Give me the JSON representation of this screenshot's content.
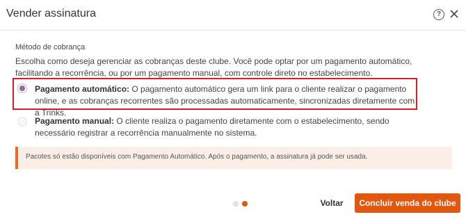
{
  "dialog": {
    "title": "Vender assinatura",
    "help_icon": "question-circle-icon",
    "close_icon": "close-icon"
  },
  "billing": {
    "section_label": "Método de cobrança",
    "description": "Escolha como deseja gerenciar as cobranças deste clube. Você pode optar por um pagamento automático, facilitando a recorrência, ou por um pagamento manual, com controle direto no estabelecimento.",
    "options": [
      {
        "title": "Pagamento automático:",
        "text": " O pagamento automático gera um link para o cliente realizar o pagamento online, e as cobranças recorrentes são processadas automaticamente, sincronizadas diretamente com a Trinks.",
        "selected": true
      },
      {
        "title": "Pagamento manual:",
        "text": " O cliente realiza o pagamento diretamente com o estabelecimento, sendo necessário registrar a recorrência manualmente no sistema.",
        "selected": false
      }
    ]
  },
  "alert": {
    "text": "Pacotes só estão disponíveis com Pagamento Automático. Após o pagamento, a assinatura já pode ser usada."
  },
  "footer": {
    "steps_total": 2,
    "current_step": 2,
    "back_label": "Voltar",
    "submit_label": "Concluir venda do clube"
  },
  "colors": {
    "accent": "#e2570f",
    "highlight_border": "#d01f2a",
    "radio_selected": "#8d6aa2",
    "alert_bg": "#fbeee6"
  }
}
